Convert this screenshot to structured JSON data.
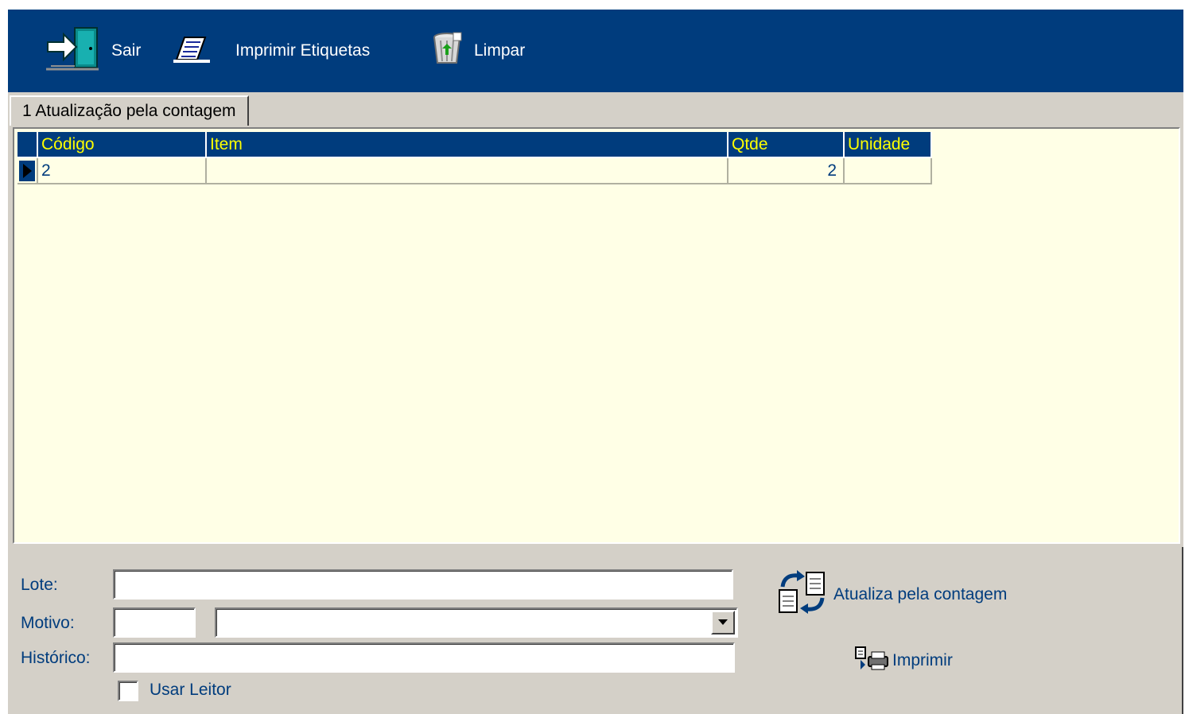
{
  "toolbar": {
    "sair_label": "Sair",
    "imprimir_etiquetas_label": "Imprimir Etiquetas",
    "limpar_label": "Limpar",
    "background": "#003c7d",
    "icons": [
      "exit-door-icon",
      "print-labels-icon",
      "recycle-bin-icon"
    ]
  },
  "tabs": [
    {
      "label": "1 Atualização pela contagem",
      "active": true
    }
  ],
  "grid": {
    "columns": [
      "Código",
      "Item",
      "Qtde",
      "Unidade"
    ],
    "rows": [
      {
        "codigo": "2",
        "item": "",
        "qtde": "2",
        "unidade": ""
      }
    ],
    "header_bg": "#003c7d",
    "header_text": "#ffff00",
    "body_bg": "#ffffe6"
  },
  "form": {
    "lote_label": "Lote:",
    "lote_value": "",
    "motivo_label": "Motivo:",
    "motivo_code": "",
    "motivo_select": "",
    "historico_label": "Histórico:",
    "historico_value": "",
    "usar_leitor_label": "Usar Leitor",
    "usar_leitor_checked": false
  },
  "actions": {
    "atualiza_label": "Atualiza pela contagem",
    "imprimir_label": "Imprimir",
    "icons": [
      "refresh-documents-icon",
      "printer-icon"
    ]
  }
}
